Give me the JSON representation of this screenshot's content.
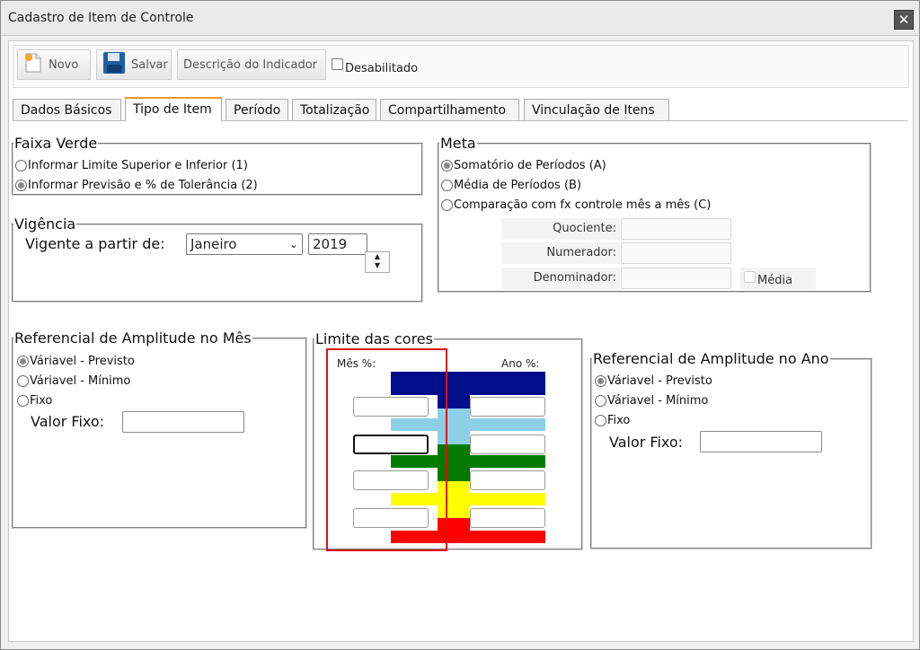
{
  "window": {
    "title": "Cadastro de Item de Controle",
    "close_symbol": "✕"
  },
  "toolbar": {
    "novo_label": "Novo",
    "salvar_label": "Salvar",
    "descricao_label": "Descrição do Indicador",
    "desabilitado_label": "Desabilitado",
    "desabilitado_checked": false
  },
  "tabs": [
    {
      "label": "Dados Básicos",
      "active": false
    },
    {
      "label": "Tipo de Item",
      "active": true
    },
    {
      "label": "Período",
      "active": false
    },
    {
      "label": "Totalização",
      "active": false
    },
    {
      "label": "Compartilhamento",
      "active": false
    },
    {
      "label": "Vinculação de Itens",
      "active": false
    }
  ],
  "faixa_verde": {
    "legend": "Faixa Verde",
    "options": [
      {
        "label": "Informar Limite Superior e Inferior (1)",
        "checked": false
      },
      {
        "label": "Informar Previsão e % de Tolerância (2)",
        "checked": true
      }
    ]
  },
  "meta": {
    "legend": "Meta",
    "options": [
      {
        "label": "Somatório de Períodos (A)",
        "checked": true
      },
      {
        "label": "Média de Períodos (B)",
        "checked": false
      },
      {
        "label": "Comparação com fx controle mês a mês (C)",
        "checked": false
      }
    ],
    "quociente_label": "Quociente:",
    "numerador_label": "Numerador:",
    "denominador_label": "Denominador:",
    "media_label": "Média",
    "quociente_value": "",
    "numerador_value": "",
    "denominador_value": ""
  },
  "vigencia": {
    "legend": "Vigência",
    "label": "Vigente a partir de:",
    "month": "Janeiro",
    "year": "2019",
    "spin_up": "▲",
    "spin_down": "▼",
    "select_arrow": "⌄"
  },
  "ref_mes": {
    "legend": "Referencial de Amplitude no Mês",
    "options": [
      {
        "label": "Váriavel - Previsto",
        "checked": true
      },
      {
        "label": "Váriavel - Mínimo",
        "checked": false
      },
      {
        "label": "Fixo",
        "checked": false
      }
    ],
    "valor_fixo_label": "Valor Fixo:",
    "valor_fixo_value": ""
  },
  "limite_cores": {
    "legend": "Limite das cores",
    "mes_label": "Mês %:",
    "ano_label": "Ano %:",
    "band_colors": [
      "#000e8a",
      "#8ecfe8",
      "#007a00",
      "#ffff00",
      "#ff0000"
    ]
  },
  "ref_ano": {
    "legend": "Referencial de Amplitude no Ano",
    "options": [
      {
        "label": "Váriavel - Previsto",
        "checked": true
      },
      {
        "label": "Váriavel - Mínimo",
        "checked": false
      },
      {
        "label": "Fixo",
        "checked": false
      }
    ],
    "valor_fixo_label": "Valor Fixo:",
    "valor_fixo_value": ""
  },
  "colors": {
    "active_tab_accent": "#e89a2c",
    "highlight": "#e01010"
  }
}
